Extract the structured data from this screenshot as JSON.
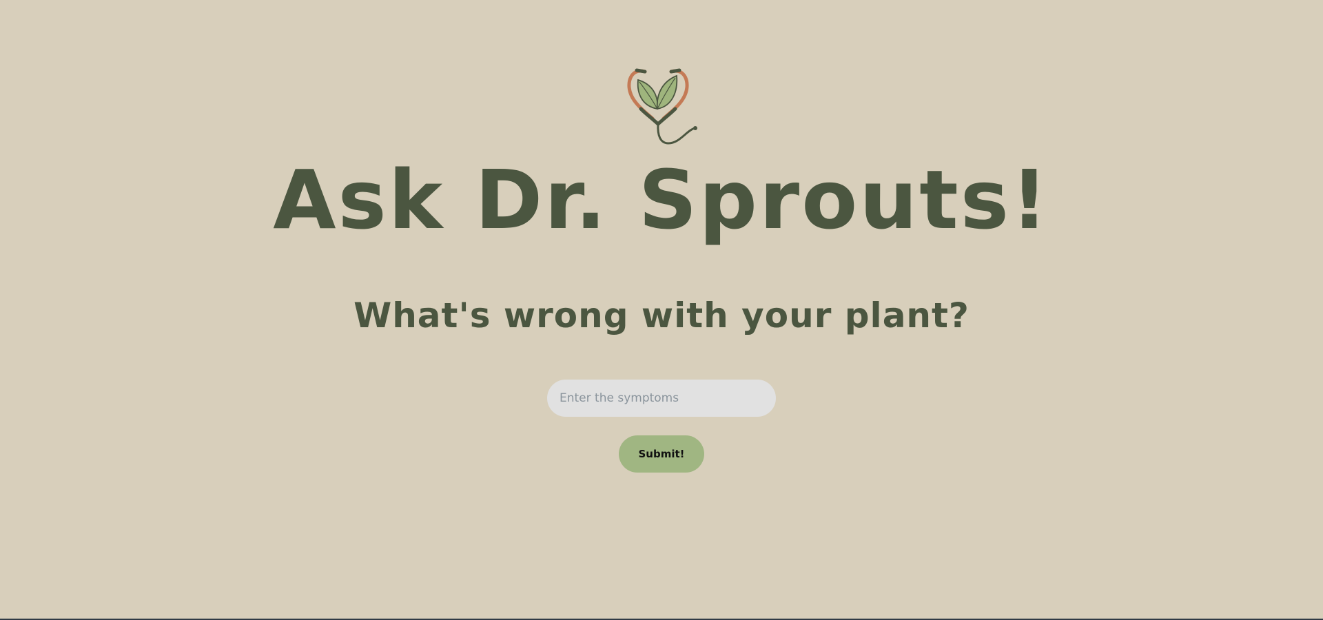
{
  "app": {
    "logo_icon": "stethoscope-sprout-icon",
    "title": "Ask Dr. Sprouts!",
    "subtitle": "What's wrong with your plant?"
  },
  "form": {
    "symptoms_placeholder": "Enter the symptoms",
    "symptoms_value": "",
    "submit_label": "Submit!"
  },
  "colors": {
    "background": "#d8cfbb",
    "text": "#4b5640",
    "input_background": "#e1e1e1",
    "button_background": "#a0b682",
    "stethoscope_copper": "#c47a55",
    "leaf_green": "#9fb57d"
  }
}
